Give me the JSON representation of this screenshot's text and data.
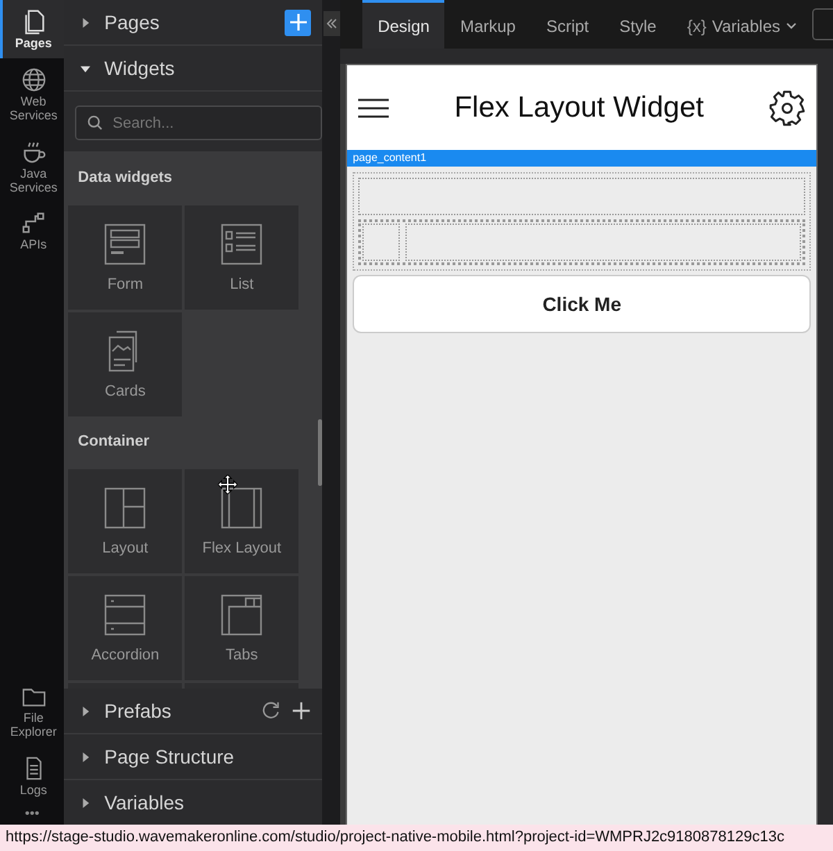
{
  "rail": {
    "items": [
      {
        "label": "Pages",
        "kind": "pages",
        "selected": true
      },
      {
        "label": "Web Services",
        "kind": "globe",
        "selected": false
      },
      {
        "label": "Java Services",
        "kind": "cup",
        "selected": false
      },
      {
        "label": "APIs",
        "kind": "api",
        "selected": false
      }
    ],
    "bottom_items": [
      {
        "label": "File Explorer",
        "kind": "folder"
      },
      {
        "label": "Logs",
        "kind": "doc"
      }
    ],
    "more": "•••"
  },
  "pages_section": {
    "title": "Pages",
    "expanded": false
  },
  "widgets_section": {
    "title": "Widgets",
    "expanded": true,
    "search": {
      "placeholder": "Search..."
    },
    "groups": [
      {
        "title": "Data widgets",
        "items": [
          {
            "label": "Form",
            "kind": "form"
          },
          {
            "label": "List",
            "kind": "list"
          },
          {
            "label": "Cards",
            "kind": "cards"
          }
        ]
      },
      {
        "title": "Container",
        "items": [
          {
            "label": "Layout",
            "kind": "layout"
          },
          {
            "label": "Flex Layout",
            "kind": "flex"
          },
          {
            "label": "Accordion",
            "kind": "accordion"
          },
          {
            "label": "Tabs",
            "kind": "tabs"
          },
          {
            "kind": "blank"
          },
          {
            "kind": "bar"
          }
        ]
      }
    ]
  },
  "lower_sections": [
    {
      "title": "Prefabs",
      "expanded": false,
      "actions": true
    },
    {
      "title": "Page Structure",
      "expanded": false,
      "actions": false
    },
    {
      "title": "Variables",
      "expanded": false,
      "actions": false
    }
  ],
  "tabs": [
    {
      "label": "Design",
      "selected": true
    },
    {
      "label": "Markup",
      "selected": false
    },
    {
      "label": "Script",
      "selected": false
    },
    {
      "label": "Style",
      "selected": false
    },
    {
      "label": "Variables",
      "prefix": "{x}",
      "selected": false
    }
  ],
  "canvas": {
    "title": "Flex Layout Widget",
    "content_label": "page_content1",
    "button": "Click Me"
  },
  "status_bar": "https://stage-studio.wavemakeronline.com/studio/project-native-mobile.html?project-id=WMPRJ2c9180878129c13c"
}
